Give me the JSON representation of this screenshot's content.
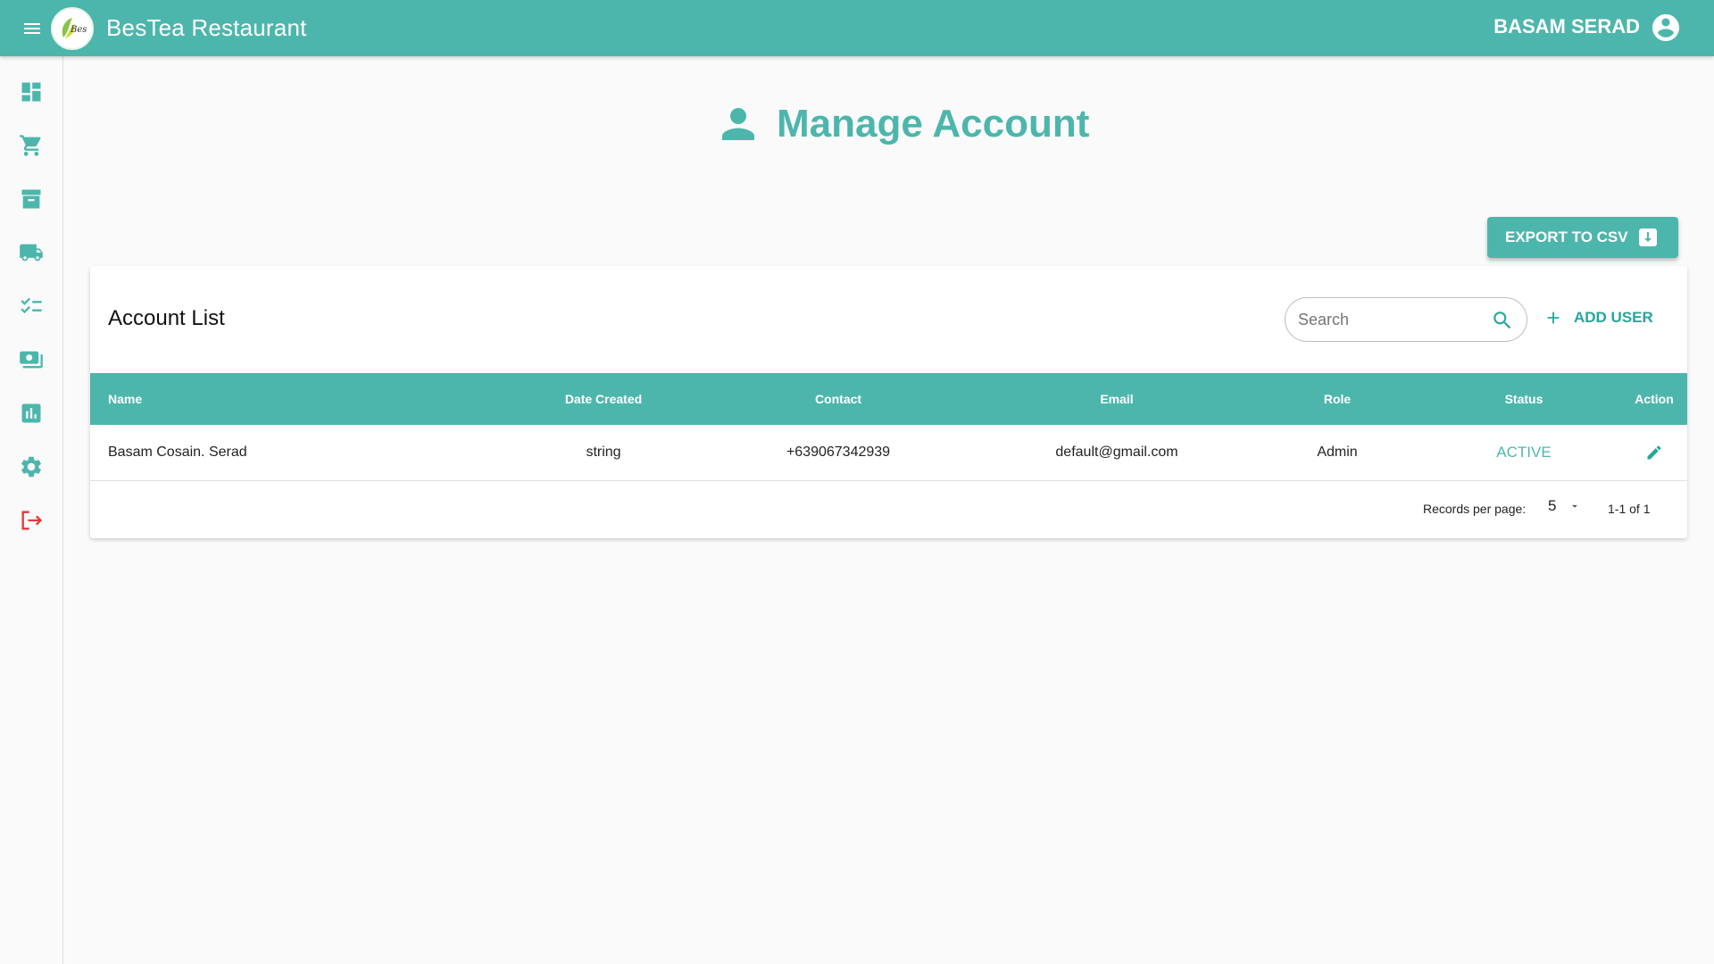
{
  "app": {
    "title": "BesTea Restaurant",
    "user_name": "BASAM SERAD"
  },
  "sidebar": {
    "items": [
      {
        "icon": "dashboard-icon"
      },
      {
        "icon": "cart-icon"
      },
      {
        "icon": "archive-icon"
      },
      {
        "icon": "truck-icon"
      },
      {
        "icon": "checklist-icon"
      },
      {
        "icon": "money-icon"
      },
      {
        "icon": "report-icon"
      },
      {
        "icon": "settings-icon"
      },
      {
        "icon": "logout-icon"
      }
    ]
  },
  "page": {
    "title": "Manage Account"
  },
  "toolbar": {
    "export_label": "EXPORT TO CSV"
  },
  "card": {
    "title": "Account List",
    "search_placeholder": "Search",
    "add_user_label": "ADD USER"
  },
  "table": {
    "headers": [
      "Name",
      "Date Created",
      "Contact",
      "Email",
      "Role",
      "Status",
      "Action"
    ],
    "rows": [
      {
        "name": "Basam Cosain. Serad",
        "date_created": "string",
        "contact": "+639067342939",
        "email": "default@gmail.com",
        "role": "Admin",
        "status": "ACTIVE"
      }
    ]
  },
  "pagination": {
    "records_label": "Records per page:",
    "per_page": "5",
    "range": "1-1 of 1"
  },
  "colors": {
    "primary": "#4db6ac",
    "logout": "#e53935",
    "icon": "#4db6ac"
  }
}
